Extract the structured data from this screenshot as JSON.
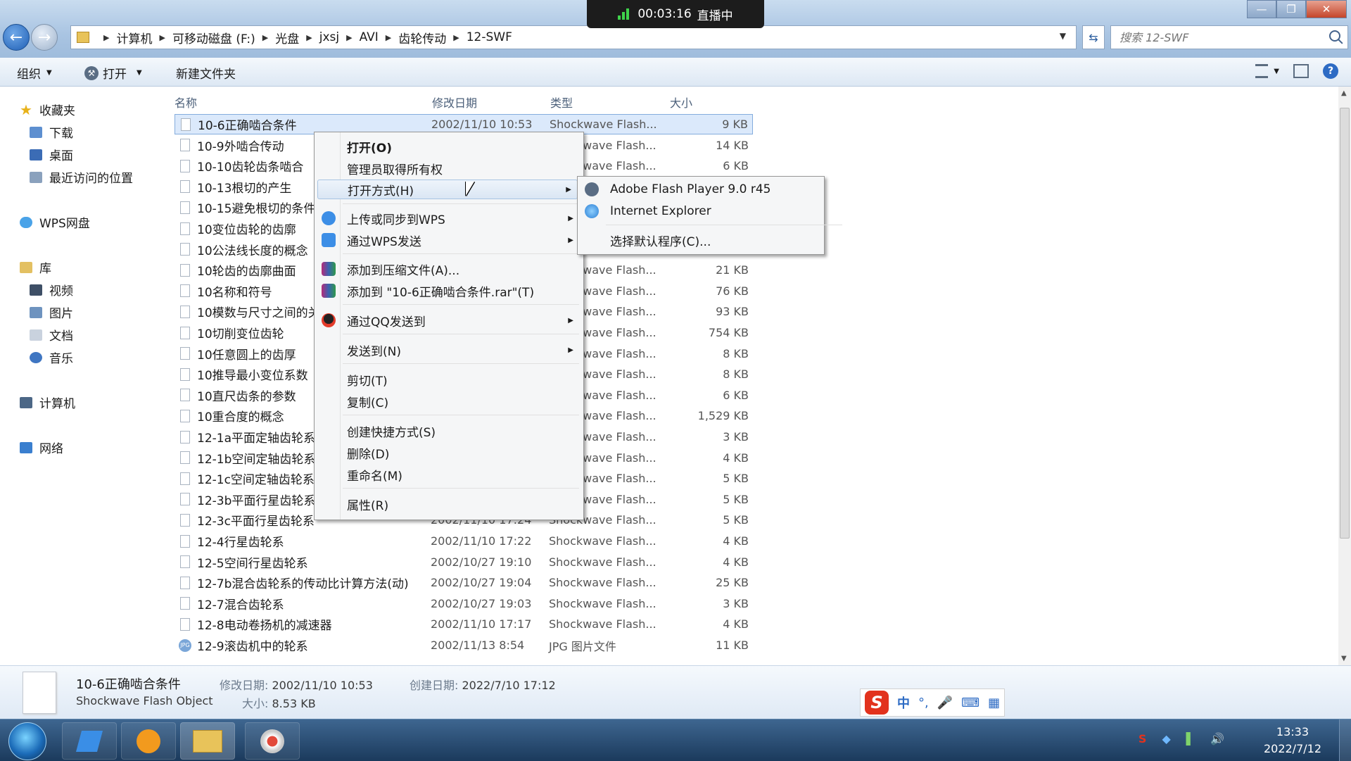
{
  "live": {
    "time": "00:03:16",
    "status": "直播中"
  },
  "address": {
    "crumbs": [
      "计算机",
      "可移动磁盘 (F:)",
      "光盘",
      "jxsj",
      "AVI",
      "齿轮传动",
      "12-SWF"
    ]
  },
  "search": {
    "placeholder": "搜索 12-SWF"
  },
  "toolbar": {
    "organize": "组织",
    "open": "打开",
    "new_folder": "新建文件夹"
  },
  "nav": {
    "favorites": "收藏夹",
    "downloads": "下载",
    "desktop": "桌面",
    "recent": "最近访问的位置",
    "wps": "WPS网盘",
    "libraries": "库",
    "videos": "视频",
    "pictures": "图片",
    "documents": "文档",
    "music": "音乐",
    "computer": "计算机",
    "network": "网络"
  },
  "columns": {
    "name": "名称",
    "date": "修改日期",
    "type": "类型",
    "size": "大小"
  },
  "files": [
    {
      "name": "10-6正确啮合条件",
      "date": "2002/11/10 10:53",
      "type": "Shockwave Flash...",
      "size": "9 KB"
    },
    {
      "name": "10-9外啮合传动",
      "date": "",
      "type": "Shockwave Flash...",
      "size": "14 KB"
    },
    {
      "name": "10-10齿轮齿条啮合",
      "date": "",
      "type": "Shockwave Flash...",
      "size": "6 KB"
    },
    {
      "name": "10-13根切的产生",
      "date": "",
      "type": "",
      "size": ""
    },
    {
      "name": "10-15避免根切的条件",
      "date": "",
      "type": "",
      "size": ""
    },
    {
      "name": "10变位齿轮的齿廓",
      "date": "",
      "type": "",
      "size": ""
    },
    {
      "name": "10公法线长度的概念",
      "date": "",
      "type": "Shockwave Flash...",
      "size": "10 KB"
    },
    {
      "name": "10轮齿的齿廓曲面",
      "date": "",
      "type": "Shockwave Flash...",
      "size": "21 KB"
    },
    {
      "name": "10名称和符号",
      "date": "",
      "type": "Shockwave Flash...",
      "size": "76 KB"
    },
    {
      "name": "10模数与尺寸之间的关系",
      "date": "",
      "type": "Shockwave Flash...",
      "size": "93 KB"
    },
    {
      "name": "10切削变位齿轮",
      "date": "",
      "type": "Shockwave Flash...",
      "size": "754 KB"
    },
    {
      "name": "10任意圆上的齿厚",
      "date": "",
      "type": "Shockwave Flash...",
      "size": "8 KB"
    },
    {
      "name": "10推导最小变位系数",
      "date": "",
      "type": "Shockwave Flash...",
      "size": "8 KB"
    },
    {
      "name": "10直尺齿条的参数",
      "date": "",
      "type": "Shockwave Flash...",
      "size": "6 KB"
    },
    {
      "name": "10重合度的概念",
      "date": "",
      "type": "Shockwave Flash...",
      "size": "1,529 KB"
    },
    {
      "name": "12-1a平面定轴齿轮系",
      "date": "",
      "type": "Shockwave Flash...",
      "size": "3 KB"
    },
    {
      "name": "12-1b空间定轴齿轮系",
      "date": "",
      "type": "Shockwave Flash...",
      "size": "4 KB"
    },
    {
      "name": "12-1c空间定轴齿轮系",
      "date": "",
      "type": "Shockwave Flash...",
      "size": "5 KB"
    },
    {
      "name": "12-3b平面行星齿轮系",
      "date": "",
      "type": "Shockwave Flash...",
      "size": "5 KB"
    },
    {
      "name": "12-3c平面行星齿轮系",
      "date": "2002/11/10 17:24",
      "type": "Shockwave Flash...",
      "size": "5 KB"
    },
    {
      "name": "12-4行星齿轮系",
      "date": "2002/11/10 17:22",
      "type": "Shockwave Flash...",
      "size": "4 KB"
    },
    {
      "name": "12-5空间行星齿轮系",
      "date": "2002/10/27 19:10",
      "type": "Shockwave Flash...",
      "size": "4 KB"
    },
    {
      "name": "12-7b混合齿轮系的传动比计算方法(动)",
      "date": "2002/10/27 19:04",
      "type": "Shockwave Flash...",
      "size": "25 KB"
    },
    {
      "name": "12-7混合齿轮系",
      "date": "2002/10/27 19:03",
      "type": "Shockwave Flash...",
      "size": "3 KB"
    },
    {
      "name": "12-8电动卷扬机的减速器",
      "date": "2002/11/10 17:17",
      "type": "Shockwave Flash...",
      "size": "4 KB"
    },
    {
      "name": "12-9滚齿机中的轮系",
      "date": "2002/11/13 8:54",
      "type": "JPG 图片文件",
      "size": "11 KB"
    }
  ],
  "context_menu": {
    "open": "打开(O)",
    "take_ownership": "管理员取得所有权",
    "open_with": "打开方式(H)",
    "upload_wps": "上传或同步到WPS",
    "send_wps": "通过WPS发送",
    "add_archive": "添加到压缩文件(A)...",
    "add_rar": "添加到 \"10-6正确啮合条件.rar\"(T)",
    "send_qq": "通过QQ发送到",
    "send_to": "发送到(N)",
    "cut": "剪切(T)",
    "copy": "复制(C)",
    "create_shortcut": "创建快捷方式(S)",
    "delete": "删除(D)",
    "rename": "重命名(M)",
    "properties": "属性(R)"
  },
  "submenu": {
    "flash": "Adobe Flash Player 9.0  r45",
    "ie": "Internet Explorer",
    "choose": "选择默认程序(C)..."
  },
  "details": {
    "name": "10-6正确啮合条件",
    "kind": "Shockwave Flash Object",
    "modified_label": "修改日期:",
    "modified": "2002/11/10 10:53",
    "size_label": "大小:",
    "size": "8.53 KB",
    "created_label": "创建日期:",
    "created": "2022/7/10 17:12"
  },
  "ime": {
    "mode": "中"
  },
  "clock": {
    "time": "13:33",
    "date": "2022/7/12"
  }
}
